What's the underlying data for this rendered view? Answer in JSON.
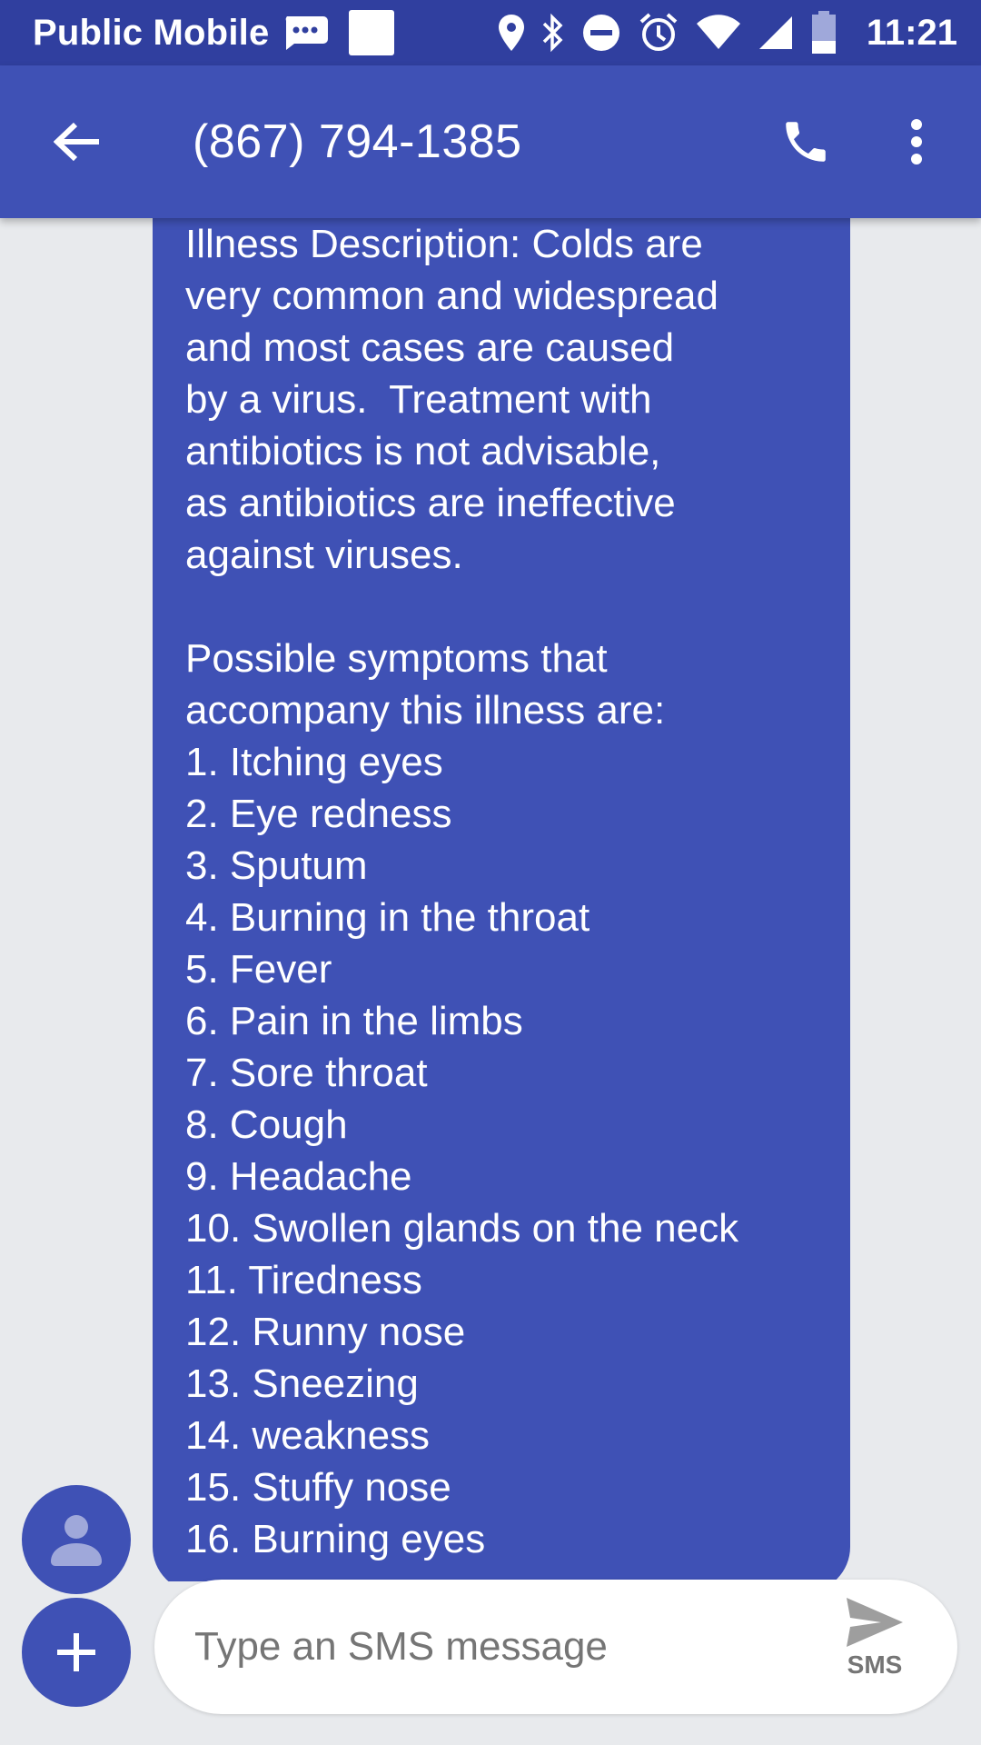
{
  "status_bar": {
    "carrier": "Public Mobile",
    "time": "11:21",
    "icons": [
      "sms-notification-icon",
      "image-notification-icon",
      "location-icon",
      "bluetooth-icon",
      "do-not-disturb-icon",
      "alarm-icon",
      "wifi-icon",
      "signal-icon",
      "battery-icon"
    ]
  },
  "app_bar": {
    "title": "(867) 794-1385",
    "icons": [
      "back-arrow-icon",
      "phone-icon",
      "more-vert-icon"
    ]
  },
  "message": {
    "lines": [
      "Illness Description: Colds are",
      "very common and widespread",
      "and most cases are caused",
      "by a virus.  Treatment with",
      "antibiotics is not advisable,",
      "as antibiotics are ineffective",
      "against viruses.",
      "",
      "Possible symptoms that",
      "accompany this illness are:",
      "1. Itching eyes",
      "2. Eye redness",
      "3. Sputum",
      "4. Burning in the throat",
      "5. Fever",
      "6. Pain in the limbs",
      "7. Sore throat",
      "8. Cough",
      "9. Headache",
      "10. Swollen glands on the neck",
      "11. Tiredness",
      "12. Runny nose",
      "13. Sneezing",
      "14. weakness",
      "15. Stuffy nose",
      "16. Burning eyes"
    ]
  },
  "compose": {
    "placeholder": "Type an SMS message",
    "send_label": "SMS"
  },
  "colors": {
    "status_bar": "#303f9f",
    "primary": "#3f51b5",
    "background": "#e8eaed"
  }
}
